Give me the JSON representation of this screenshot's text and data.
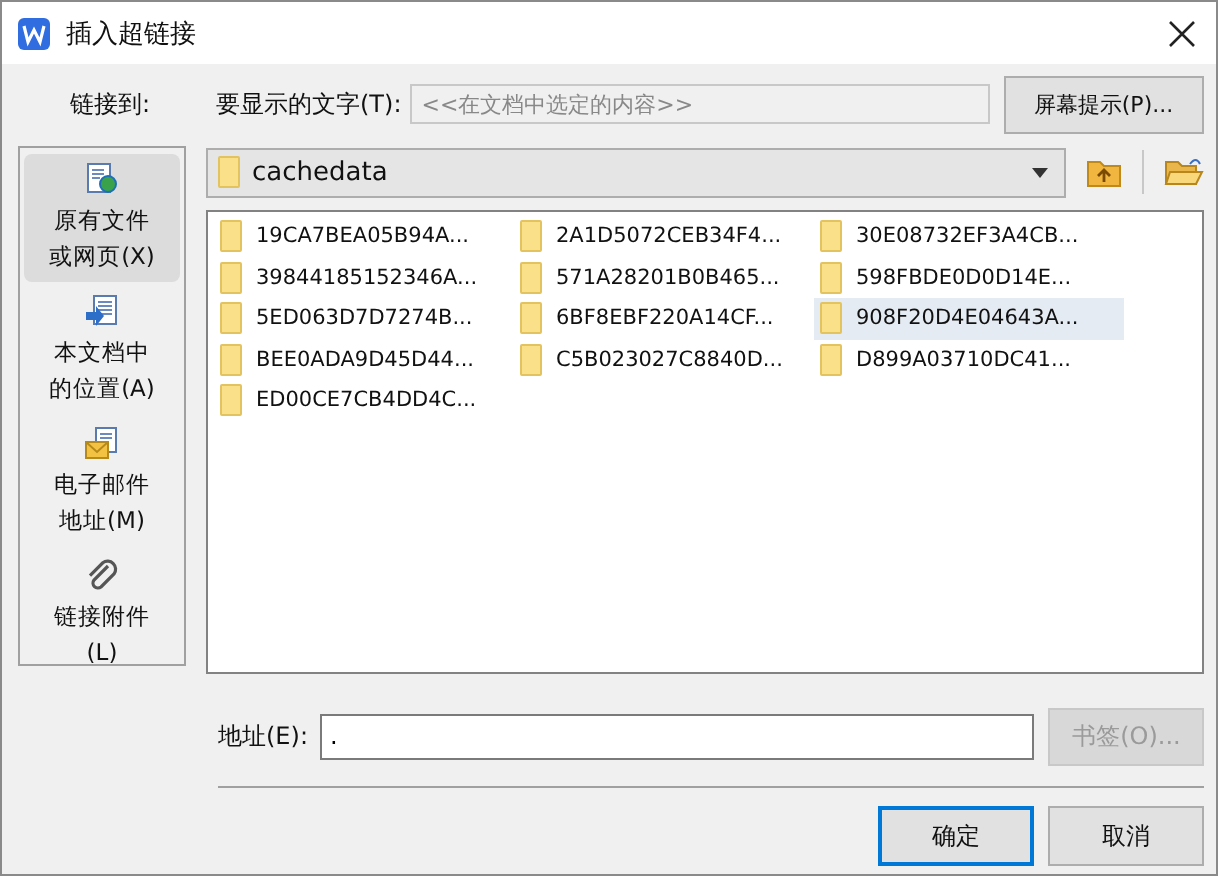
{
  "window": {
    "title": "插入超链接"
  },
  "link_to_label": "链接到:",
  "display_text": {
    "label": "要显示的文字(T):",
    "placeholder": "<<在文档中选定的内容>>"
  },
  "screentip_button": "屏幕提示(P)...",
  "sidebar": {
    "items": [
      {
        "label": "原有文件或网页(X)",
        "kind": "file",
        "selected": true
      },
      {
        "label": "本文档中的位置(A)",
        "kind": "place",
        "selected": false
      },
      {
        "label": "电子邮件地址(M)",
        "kind": "email",
        "selected": false
      },
      {
        "label": "链接附件(L)",
        "kind": "attach",
        "selected": false
      }
    ]
  },
  "folder": {
    "value": "cachedata"
  },
  "files": [
    {
      "name": "19CA7BEA05B94A...",
      "selected": false
    },
    {
      "name": "2A1D5072CEB34F4...",
      "selected": false
    },
    {
      "name": "30E08732EF3A4CB...",
      "selected": false
    },
    {
      "name": "39844185152346A...",
      "selected": false
    },
    {
      "name": "571A28201B0B465...",
      "selected": false
    },
    {
      "name": "598FBDE0D0D14E...",
      "selected": false
    },
    {
      "name": "5ED063D7D7274B...",
      "selected": false
    },
    {
      "name": "6BF8EBF220A14CF...",
      "selected": false
    },
    {
      "name": "908F20D4E04643A...",
      "selected": true
    },
    {
      "name": "BEE0ADA9D45D44...",
      "selected": false
    },
    {
      "name": "C5B023027C8840D...",
      "selected": false
    },
    {
      "name": "D899A03710DC41...",
      "selected": false
    },
    {
      "name": "ED00CE7CB4DD4C...",
      "selected": false
    }
  ],
  "address": {
    "label": "地址(E):",
    "value": "."
  },
  "bookmark_button": {
    "label": "书签(O)...",
    "disabled": true
  },
  "ok_button": "确定",
  "cancel_button": "取消"
}
